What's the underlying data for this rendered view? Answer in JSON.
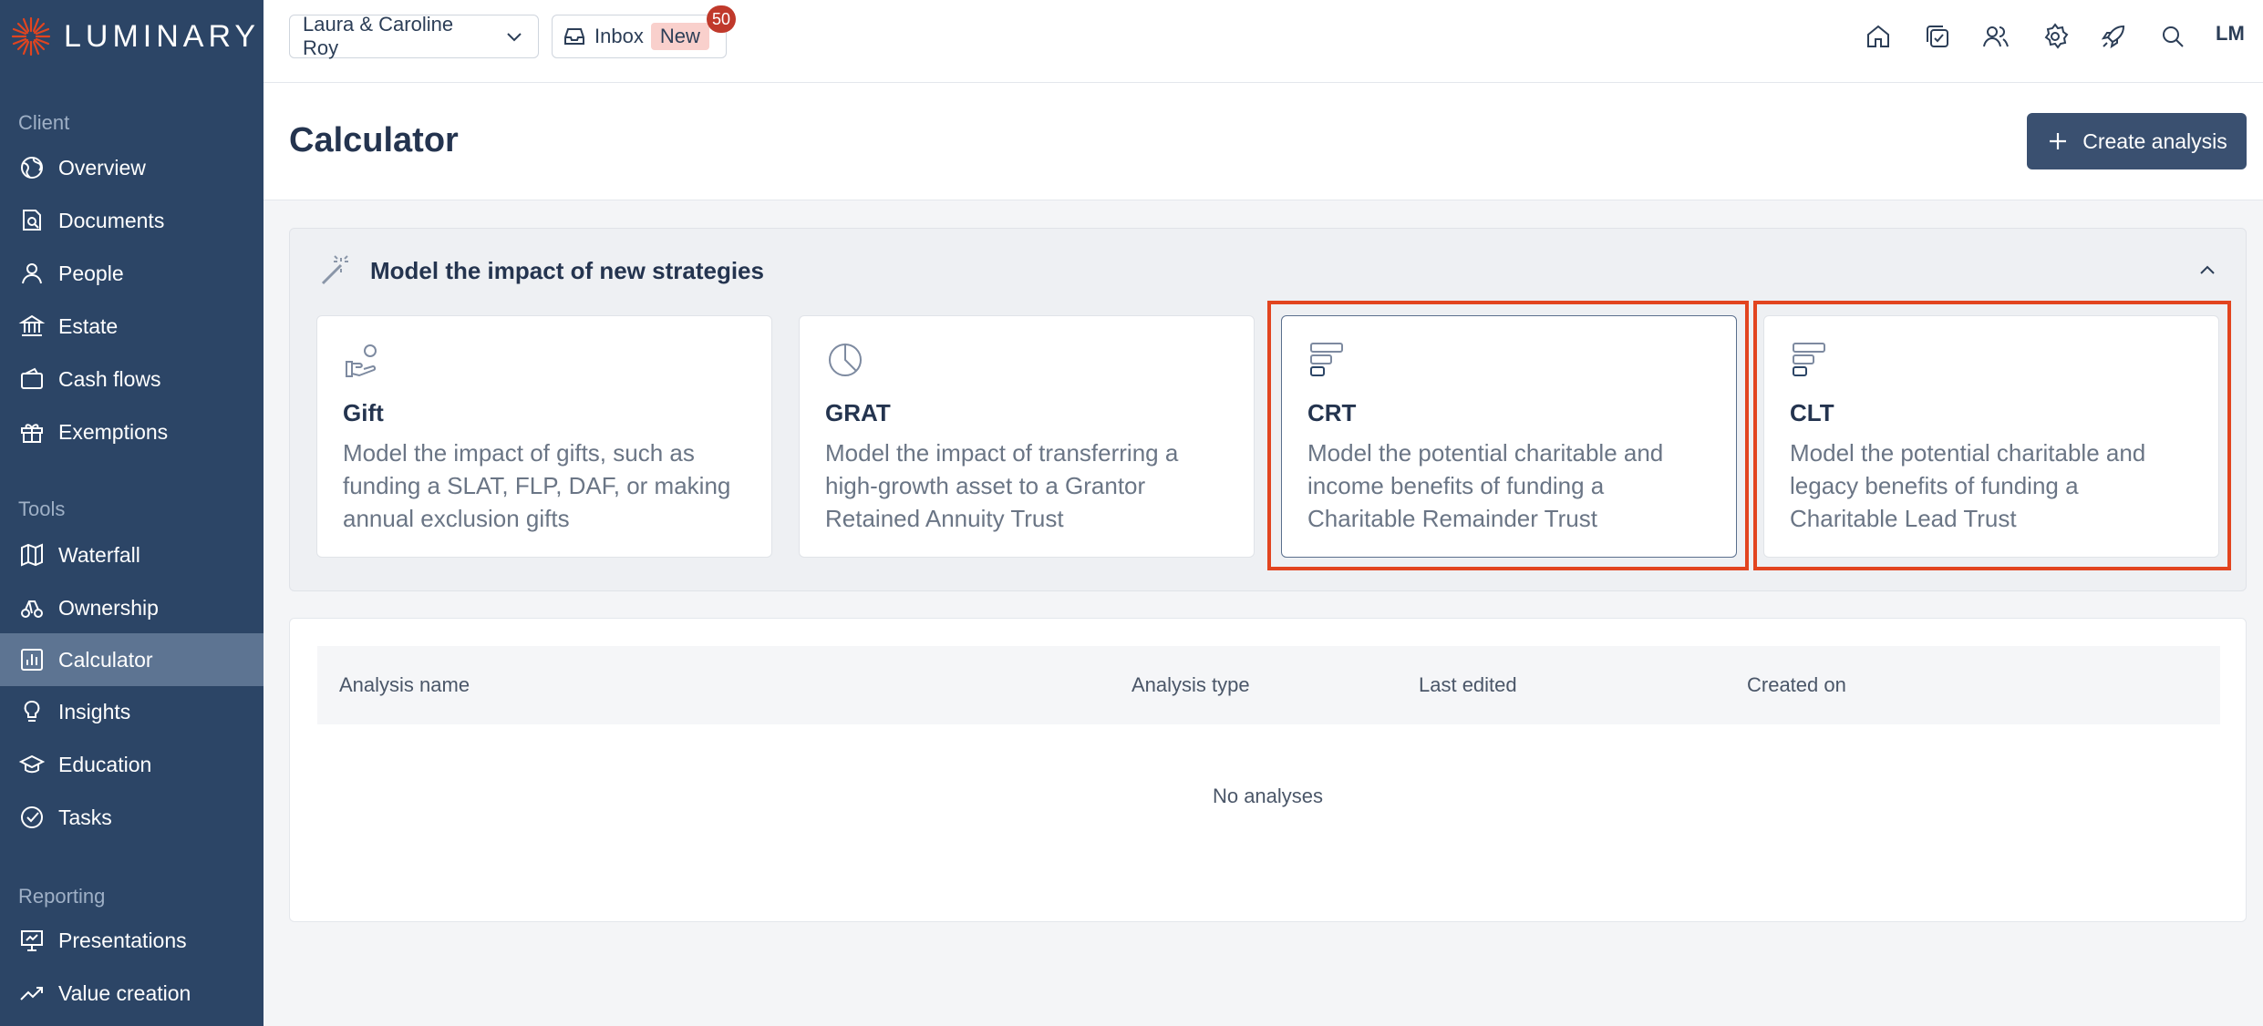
{
  "brand": {
    "name": "LUMINARY",
    "accent": "#e2441f",
    "sidebar_bg": "#2c4566"
  },
  "sidebar": {
    "sections": [
      {
        "label": "Client"
      },
      {
        "label": "Tools"
      },
      {
        "label": "Reporting"
      }
    ],
    "items": [
      {
        "label": "Overview",
        "icon": "globe-icon"
      },
      {
        "label": "Documents",
        "icon": "document-search-icon"
      },
      {
        "label": "People",
        "icon": "person-icon"
      },
      {
        "label": "Estate",
        "icon": "bank-icon"
      },
      {
        "label": "Cash flows",
        "icon": "wallet-icon"
      },
      {
        "label": "Exemptions",
        "icon": "gift-icon"
      },
      {
        "label": "Waterfall",
        "icon": "map-icon"
      },
      {
        "label": "Ownership",
        "icon": "hierarchy-icon"
      },
      {
        "label": "Calculator",
        "icon": "chart-icon",
        "active": true
      },
      {
        "label": "Insights",
        "icon": "lightbulb-icon"
      },
      {
        "label": "Education",
        "icon": "graduation-cap-icon"
      },
      {
        "label": "Tasks",
        "icon": "check-circle-icon"
      },
      {
        "label": "Presentations",
        "icon": "presentation-icon"
      },
      {
        "label": "Value creation",
        "icon": "trend-up-icon"
      }
    ]
  },
  "topbar": {
    "client_name": "Laura & Caroline Roy",
    "inbox_label": "Inbox",
    "new_label": "New",
    "inbox_count": "50",
    "user_initials": "LM",
    "icons": [
      "home-icon",
      "tasks-icon",
      "users-icon",
      "settings-icon",
      "rocket-icon",
      "search-icon"
    ]
  },
  "header": {
    "title": "Calculator",
    "create_label": "Create analysis"
  },
  "strategies": {
    "title": "Model the impact of new strategies",
    "cards": [
      {
        "title": "Gift",
        "description": "Model the impact of gifts, such as funding a SLAT, FLP, DAF, or making annual exclusion gifts"
      },
      {
        "title": "GRAT",
        "description": "Model the impact of transferring a high-growth asset to a Grantor Retained Annuity Trust"
      },
      {
        "title": "CRT",
        "description": "Model the potential charitable and income benefits of funding a Charitable Remainder Trust"
      },
      {
        "title": "CLT",
        "description": "Model the potential charitable and legacy benefits of funding a Charitable Lead Trust"
      }
    ]
  },
  "table": {
    "columns": [
      "Analysis name",
      "Analysis type",
      "Last edited",
      "Created on"
    ],
    "empty_text": "No analyses"
  }
}
